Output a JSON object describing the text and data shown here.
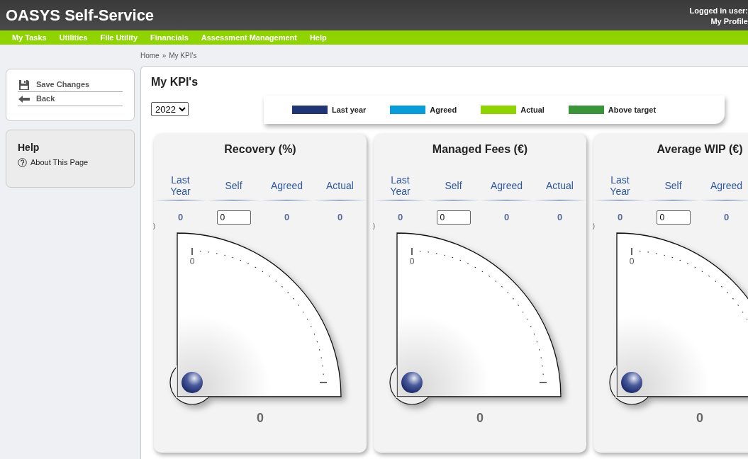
{
  "header": {
    "title": "OASYS Self-Service",
    "user_label": "Logged in user:",
    "profile_link": "My Profile"
  },
  "menu": [
    "My Tasks",
    "Utilities",
    "File Utility",
    "Financials",
    "Assessment Management",
    "Help"
  ],
  "breadcrumb": {
    "items": [
      "Home",
      "My KPI's"
    ],
    "separator": "»"
  },
  "sidebar": {
    "actions": [
      {
        "label": "Save Changes",
        "kind": "save"
      },
      {
        "label": "Back",
        "kind": "back"
      }
    ],
    "help": {
      "title": "Help",
      "links": [
        {
          "label": "About This Page",
          "kind": "help"
        }
      ]
    }
  },
  "page": {
    "title": "My KPI's",
    "year": "2022",
    "legend": [
      {
        "label": "Last year",
        "color": "#1f3574"
      },
      {
        "label": "Agreed",
        "color": "#0a9bd9"
      },
      {
        "label": "Actual",
        "color": "#8fd400"
      },
      {
        "label": "Above target",
        "color": "#3a953a"
      }
    ],
    "kpis": [
      {
        "title": "Recovery (%)",
        "note": ")",
        "columns": [
          {
            "label": "Last Year",
            "value": "0",
            "kind": "text"
          },
          {
            "label": "Self",
            "value": "0",
            "kind": "input"
          },
          {
            "label": "Agreed",
            "value": "0",
            "kind": "text"
          },
          {
            "label": "Actual",
            "value": "0",
            "kind": "text"
          }
        ],
        "gauge": {
          "tick_label": "0",
          "reading": "0"
        }
      },
      {
        "title": "Managed Fees (€)",
        "note": ")",
        "columns": [
          {
            "label": "Last Year",
            "value": "0",
            "kind": "text"
          },
          {
            "label": "Self",
            "value": "0",
            "kind": "input"
          },
          {
            "label": "Agreed",
            "value": "0",
            "kind": "text"
          },
          {
            "label": "Actual",
            "value": "0",
            "kind": "text"
          }
        ],
        "gauge": {
          "tick_label": "0",
          "reading": "0"
        }
      },
      {
        "title": "Average WIP (€)",
        "note": ")",
        "columns": [
          {
            "label": "Last Year",
            "value": "0",
            "kind": "text"
          },
          {
            "label": "Self",
            "value": "0",
            "kind": "input"
          },
          {
            "label": "Agreed",
            "value": "0",
            "kind": "text"
          }
        ],
        "gauge": {
          "tick_label": "0",
          "reading": "0"
        }
      }
    ]
  }
}
